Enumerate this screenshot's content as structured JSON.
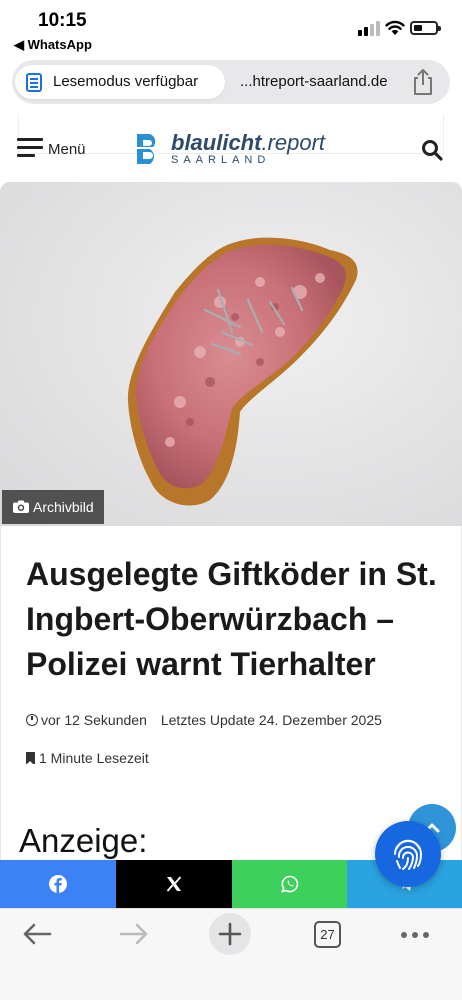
{
  "status_bar": {
    "time": "10:15",
    "back_app": "◀ WhatsApp"
  },
  "address_bar": {
    "reader_label": "Lesemodus verfügbar",
    "url": "...htreport-saarland.de"
  },
  "site_header": {
    "menu_label": "Menü",
    "logo_bold": "blaulicht",
    "logo_rest": ".report",
    "logo_sub": "SAARLAND"
  },
  "hero": {
    "caption": "Archivbild"
  },
  "article": {
    "title": "Ausgelegte Giftköder in St. Ingbert-Oberwürzbach – Polizei warnt Tierhalter",
    "posted": "vor 12 Sekunden",
    "updated": "Letztes Update 24. Dezember 2025",
    "read_time": "1 Minute Lesezeit",
    "ad_label": "Anzeige:"
  },
  "share_bar": {
    "colors": {
      "facebook": "#3b82f6",
      "x": "#000000",
      "whatsapp": "#3fcf5c",
      "telegram": "#2aa3e0"
    }
  },
  "toolbar": {
    "tab_count": "27"
  },
  "colors": {
    "accent_blue": "#1667e0",
    "logo_blue": "#2c4a6a"
  }
}
